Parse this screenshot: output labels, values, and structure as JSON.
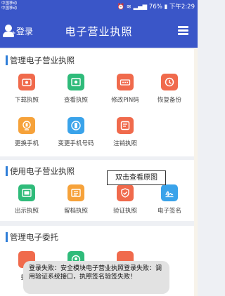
{
  "status_bar": {
    "carrier_1": "中国移动",
    "carrier_2": "中国移动",
    "icons": [
      "cloud-icon",
      "alarm-icon",
      "wifi-icon",
      "signal-icon"
    ],
    "battery": "76%",
    "time": "下午2:29"
  },
  "header": {
    "login_label": "登录",
    "title": "电子营业执照",
    "menu_icon": "hamburger-menu-icon"
  },
  "sections": [
    {
      "title": "管理电子营业执照",
      "items": [
        {
          "label": "下载执照",
          "icon": "download-license-icon",
          "color": "#f06a4c"
        },
        {
          "label": "查看执照",
          "icon": "view-license-icon",
          "color": "#2fbb7a"
        },
        {
          "label": "修改PIN码",
          "icon": "pin-code-icon",
          "color": "#f06a4c"
        },
        {
          "label": "恢复备份",
          "icon": "restore-backup-icon",
          "color": "#f06a4c"
        },
        {
          "label": "更换手机",
          "icon": "change-phone-icon",
          "color": "#f6a23a"
        },
        {
          "label": "变更手机号码",
          "icon": "change-phone-number-icon",
          "color": "#3aa3ea"
        },
        {
          "label": "注销执照",
          "icon": "cancel-license-icon",
          "color": "#f06a4c"
        }
      ]
    },
    {
      "title": "使用电子营业执照",
      "items": [
        {
          "label": "出示执照",
          "icon": "show-license-icon",
          "color": "#2fbb7a"
        },
        {
          "label": "留档执照",
          "icon": "archive-license-icon",
          "color": "#f6a23a"
        },
        {
          "label": "验证执照",
          "icon": "verify-license-icon",
          "color": "#f06a4c"
        },
        {
          "label": "电子签名",
          "icon": "e-signature-icon",
          "color": "#3aa3ea"
        }
      ]
    },
    {
      "title": "管理电子委托",
      "items": [
        {
          "label": "委托",
          "icon": "delegate-icon",
          "color": "#f06a4c"
        },
        {
          "label": "",
          "icon": "delegate-manage-icon",
          "color": "#2fbb7a"
        },
        {
          "label": "",
          "icon": "delegate-query-icon",
          "color": "#f06a4c"
        }
      ]
    }
  ],
  "tooltip": "双击查看原图",
  "toast": "登录失败：安全模块电子营业执照登录失败：调用验证系统接口，执照签名验签失败！"
}
